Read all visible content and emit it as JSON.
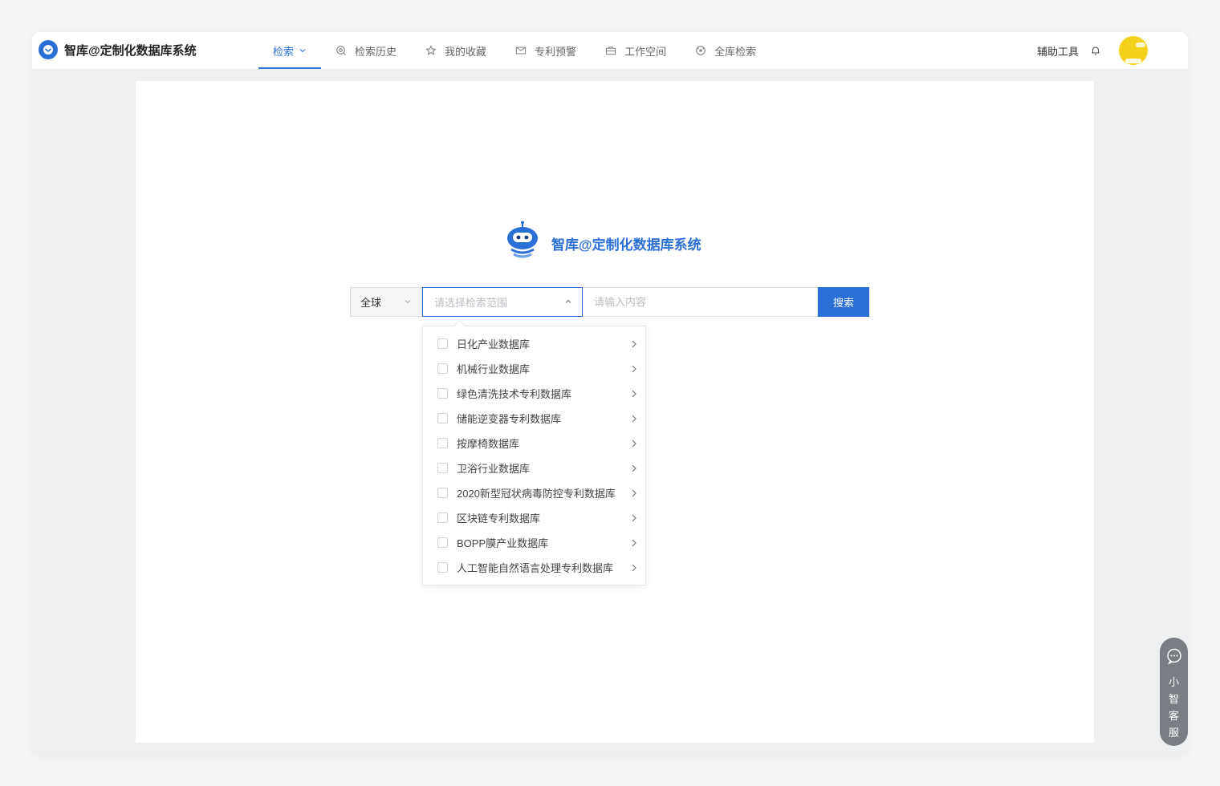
{
  "app": {
    "title": "智库@定制化数据库系统"
  },
  "nav": {
    "items": [
      {
        "label": "检索",
        "icon": "chevron-down-icon",
        "active": true
      },
      {
        "label": "检索历史",
        "icon": "search-history-icon"
      },
      {
        "label": "我的收藏",
        "icon": "star-icon"
      },
      {
        "label": "专利预警",
        "icon": "warning-mail-icon"
      },
      {
        "label": "工作空间",
        "icon": "briefcase-icon"
      },
      {
        "label": "全库检索",
        "icon": "globe-icon"
      }
    ]
  },
  "header": {
    "tools_label": "辅助工具",
    "bell_icon": "bell-icon",
    "avatar_icon": "avatar-icon"
  },
  "hero": {
    "title": "智库@定制化数据库系统",
    "icon": "robot-logo-icon"
  },
  "search": {
    "scope_value": "全球",
    "range_placeholder": "请选择检索范围",
    "query_placeholder": "请输入内容",
    "button_label": "搜索"
  },
  "dropdown": {
    "items": [
      {
        "label": "日化产业数据库"
      },
      {
        "label": "机械行业数据库"
      },
      {
        "label": "绿色清洗技术专利数据库"
      },
      {
        "label": "储能逆变器专利数据库"
      },
      {
        "label": "按摩椅数据库"
      },
      {
        "label": "卫浴行业数据库"
      },
      {
        "label": "2020新型冠状病毒防控专利数据库"
      },
      {
        "label": "区块链专利数据库"
      },
      {
        "label": "BOPP膜产业数据库"
      },
      {
        "label": "人工智能自然语言处理专利数据库"
      }
    ]
  },
  "service": {
    "label": "小智客服",
    "icon": "chat-bubble-icon"
  },
  "colors": {
    "accent": "#2a6fd6",
    "service_bg": "#7a7e84",
    "avatar": "#f5d11b"
  }
}
